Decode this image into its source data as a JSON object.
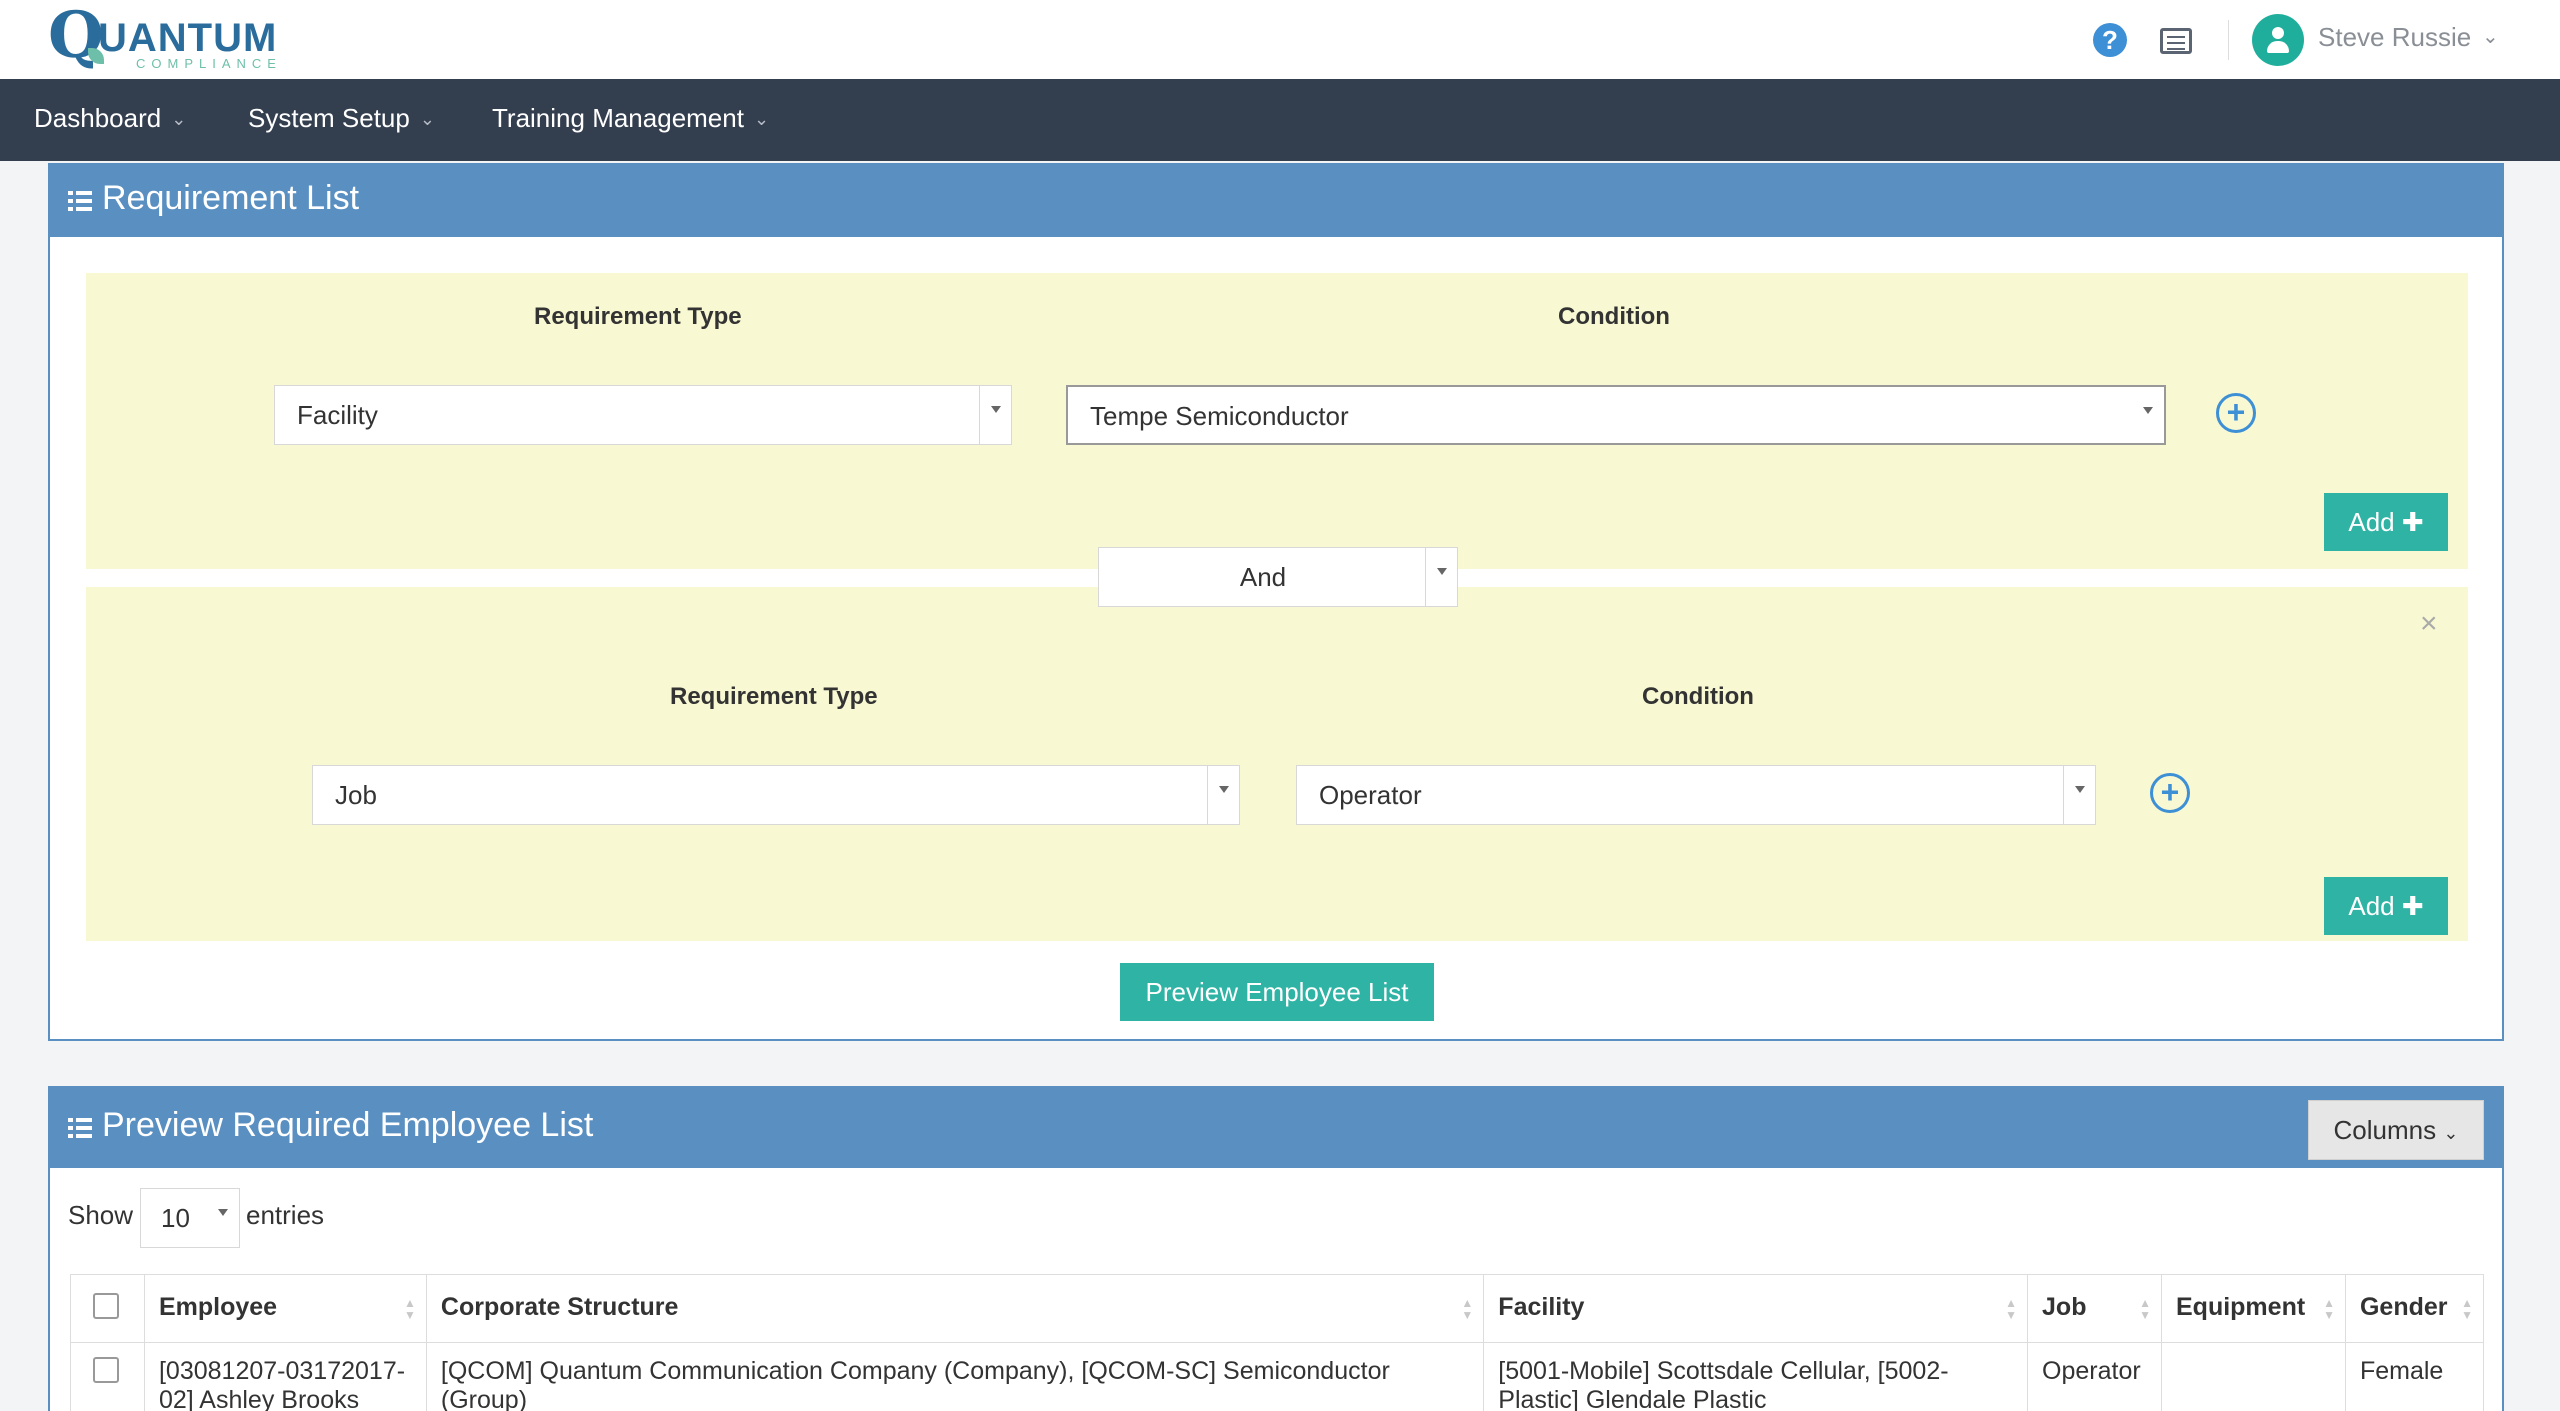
{
  "app": {
    "logo_main": "UANTUM",
    "logo_q": "Q",
    "logo_sub": "COMPLIANCE",
    "help_icon": "?",
    "user_name": "Steve Russie"
  },
  "nav": {
    "items": [
      {
        "label": "Dashboard"
      },
      {
        "label": "System Setup"
      },
      {
        "label": "Training Management"
      }
    ]
  },
  "requirement_list": {
    "title": "Requirement List",
    "group1": {
      "type_label": "Requirement Type",
      "condition_label": "Condition",
      "type_value": "Facility",
      "condition_value": "Tempe Semiconductor",
      "add_label": "Add ✚"
    },
    "operator": "And",
    "group2": {
      "type_label": "Requirement Type",
      "condition_label": "Condition",
      "type_value": "Job",
      "condition_value": "Operator",
      "add_label": "Add ✚",
      "close": "×"
    },
    "preview_button": "Preview Employee List"
  },
  "employee_list": {
    "title": "Preview Required Employee List",
    "columns_button": "Columns",
    "show_label": "Show",
    "show_value": "10",
    "entries_label": "entries",
    "headers": [
      "Employee",
      "Corporate Structure",
      "Facility",
      "Job",
      "Equipment",
      "Gender"
    ],
    "rows": [
      {
        "employee": "[03081207-03172017-02] Ashley Brooks",
        "corporate_structure": "[QCOM] Quantum Communication Company (Company), [QCOM-SC] Semiconductor (Group)",
        "facility": "[5001-Mobile] Scottsdale Cellular, [5002-Plastic] Glendale Plastic",
        "job": "Operator",
        "equipment": "",
        "gender": "Female"
      }
    ]
  },
  "colors": {
    "nav_bg": "#333e4f",
    "panel_header": "#5a8fc2",
    "teal": "#2fb3a4",
    "req_box": "#f8f8d2"
  }
}
